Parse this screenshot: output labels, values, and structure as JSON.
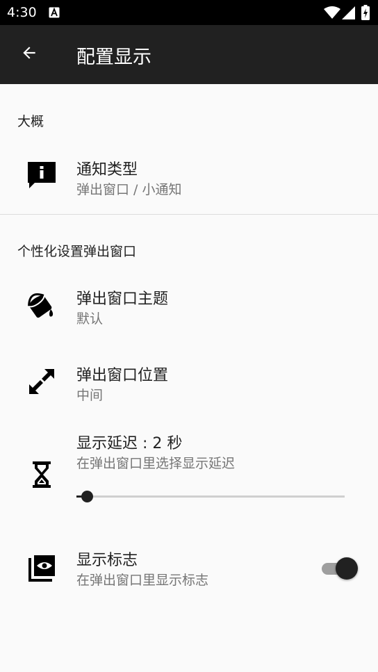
{
  "status_bar": {
    "time": "4:30",
    "icons": [
      "text-notification-icon",
      "wifi-icon",
      "signal-icon",
      "battery-charging-icon"
    ]
  },
  "app_bar": {
    "title": "配置显示",
    "back_icon": "arrow-back-icon"
  },
  "sections": {
    "general": {
      "header": "大概",
      "notification_type": {
        "icon": "feedback-info-icon",
        "title": "通知类型",
        "summary": "弹出窗口 / 小通知"
      }
    },
    "popup": {
      "header": "个性化设置弹出窗口",
      "theme": {
        "icon": "paint-bucket-icon",
        "title": "弹出窗口主题",
        "summary": "默认"
      },
      "position": {
        "icon": "expand-diagonal-icon",
        "title": "弹出窗口位置",
        "summary": "中间"
      },
      "delay": {
        "icon": "hourglass-icon",
        "title": "显示延迟 : 2 秒",
        "summary": "在弹出窗口里选择显示延迟",
        "slider_fraction": 0.03
      },
      "show_logo": {
        "icon": "eye-image-icon",
        "title": "显示标志",
        "summary": "在弹出窗口里显示标志",
        "enabled": true
      }
    }
  },
  "colors": {
    "app_bar": "#212121",
    "status_bar": "#000000",
    "background": "#fafafa",
    "accent": "#212121"
  }
}
